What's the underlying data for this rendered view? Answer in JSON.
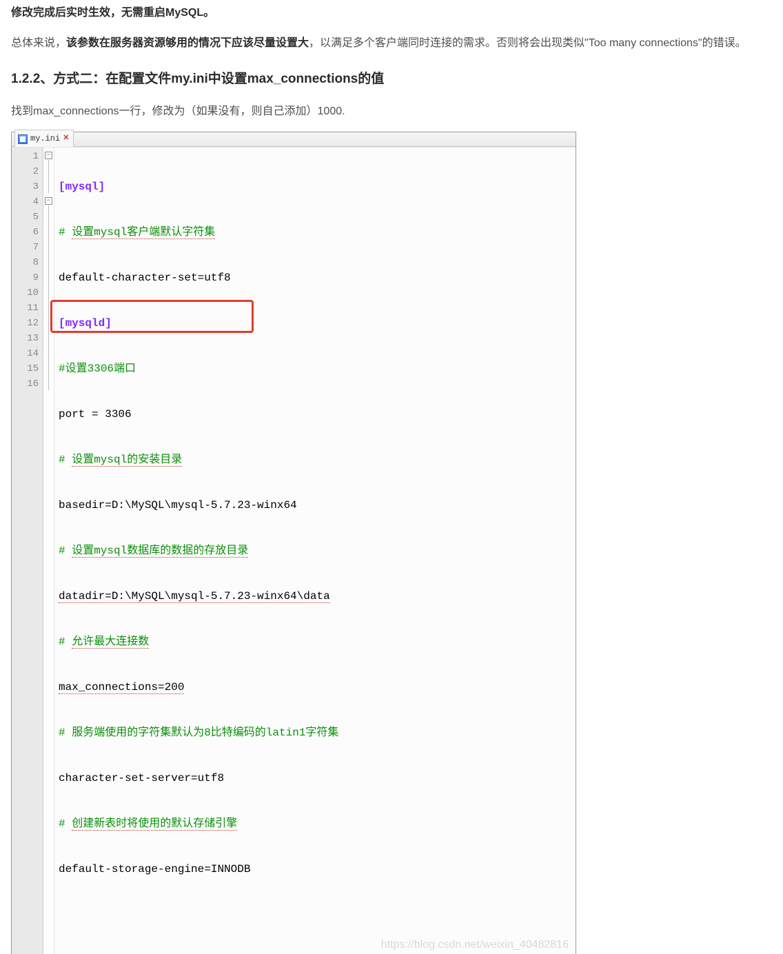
{
  "text": {
    "p1_bold": "修改完成后实时生效，无需重启MySQL。",
    "p2_prefix": "总体来说，",
    "p2_bold": "该参数在服务器资源够用的情况下应该尽量设置大",
    "p2_suffix": "，以满足多个客户端同时连接的需求。否则将会出现类似\"Too many connections\"的错误。",
    "h3": "1.2.2、方式二：在配置文件my.ini中设置max_connections的值",
    "p3": "找到max_connections一行，修改为（如果没有，则自己添加）1000."
  },
  "editor": {
    "tab_label": "my.ini",
    "watermark": "https://blog.csdn.net/weixin_40482816",
    "line_count": 16,
    "fold_marks": {
      "line1": 1,
      "line4": 4
    }
  },
  "code": {
    "l1": {
      "section": "[mysql]"
    },
    "l2": {
      "hash": "# ",
      "ul": "设置mysql客户端默认字符集"
    },
    "l3": {
      "plain": "default-character-set=utf8"
    },
    "l4": {
      "section": "[mysqld]"
    },
    "l5": {
      "hash": "#",
      "plain": "设置3306端口"
    },
    "l6": {
      "plain": "port = 3306"
    },
    "l7": {
      "hash": "# ",
      "ul": "设置mysql的安装目录"
    },
    "l8": {
      "plain": "basedir=D:\\MySQL\\mysql-5.7.23-winx64"
    },
    "l9": {
      "hash": "# ",
      "ul": "设置mysql数据库的数据的存放目录"
    },
    "l10": {
      "plain_ul": "datadir=D:\\MySQL\\mysql-5.7.23-winx64\\data"
    },
    "l11": {
      "hash": "# ",
      "ul": "允许最大连接数"
    },
    "l12": {
      "plain_ul": "max_connections=200"
    },
    "l13": {
      "hash": "# ",
      "plain": "服务端使用的字符集默认为8比特编码的latin1字符集"
    },
    "l14": {
      "plain": "character-set-server=utf8"
    },
    "l15": {
      "hash": "# ",
      "ul": "创建新表时将使用的默认存储引擎"
    },
    "l16": {
      "plain": "default-storage-engine=INNODB"
    }
  }
}
